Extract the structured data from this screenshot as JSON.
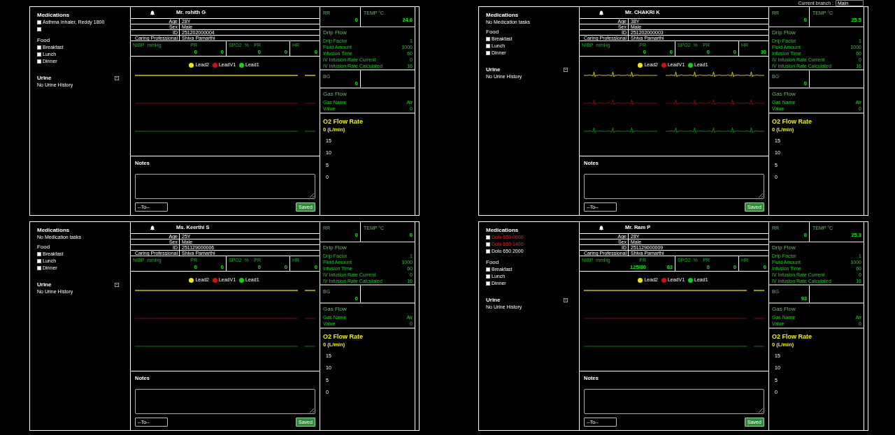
{
  "branch": {
    "label": "Current branch :",
    "value": "Main"
  },
  "panels": [
    {
      "medications": {
        "title": "Medications",
        "items": [
          {
            "label": "Asthma Inhaler, Reddy 1800",
            "checked": false,
            "overdue": false
          },
          {
            "checked": false
          }
        ]
      },
      "food": {
        "title": "Food",
        "items": [
          {
            "label": "Breakfast",
            "checked": false
          },
          {
            "label": "Lunch",
            "checked": false
          },
          {
            "label": "Dinner",
            "checked": false
          }
        ]
      },
      "urine": {
        "title": "Urine",
        "empty_text": "No Urine History"
      },
      "patient": {
        "name": "Mr. rohith G",
        "fields": [
          {
            "label": "Age",
            "value": "28Y"
          },
          {
            "label": "Sex",
            "value": "Male"
          },
          {
            "label": "ID",
            "value": "251202000004"
          },
          {
            "label": "Caring Professional",
            "value": "Shiva Pamarthi"
          }
        ]
      },
      "vitals": [
        {
          "label": "NIBP mmHg",
          "sub_label": "PR",
          "value": "0",
          "sub_value": "0"
        },
        {
          "label": "SPO2 %",
          "sub_label": "PR",
          "value": "0",
          "sub_value": "0"
        },
        {
          "label": "HR",
          "value": "0"
        }
      ],
      "ecg": {
        "signal": false,
        "leads": [
          {
            "name": "Lead2",
            "color": "#f2e21c"
          },
          {
            "name": "LeadV1",
            "color": "#c81414"
          },
          {
            "name": "Lead1",
            "color": "#1ec81e"
          }
        ]
      },
      "notes": {
        "title": "Notes",
        "recipient": "--To--",
        "button": "Saved"
      },
      "rr": {
        "label": "RR",
        "value": "0"
      },
      "temp": {
        "label": "TEMP °C",
        "value": "24.6"
      },
      "drip_flow": {
        "title": "Drip Flow",
        "rows": [
          {
            "label": "Drip Factor",
            "value": "1"
          },
          {
            "label": "Fluid Amount",
            "value": "1000"
          },
          {
            "label": "Infusion Time",
            "value": "60"
          },
          {
            "label": "IV Infusion Rate Current",
            "value": "0"
          },
          {
            "label": "IV Infusion Rate Calculated",
            "value": "16"
          }
        ]
      },
      "bg": {
        "label": "BG",
        "value": "0"
      },
      "gas_flow": {
        "title": "Gas Flow",
        "rows": [
          {
            "label": "Gas Name",
            "value": "Air"
          },
          {
            "label": "Value",
            "value": "0"
          }
        ]
      },
      "o2_flow": {
        "title": "O2 Flow Rate",
        "reading": "0 (L/min)",
        "y_ticks": [
          "15",
          "10",
          "5",
          "0"
        ]
      }
    },
    {
      "medications": {
        "title": "Medications",
        "empty_text": "No Medication tasks"
      },
      "food": {
        "title": "Food",
        "items": [
          {
            "label": "Breakfast",
            "checked": false
          },
          {
            "label": "Lunch",
            "checked": false
          },
          {
            "label": "Dinner",
            "checked": false
          }
        ]
      },
      "urine": {
        "title": "Urine",
        "empty_text": "No Urine History"
      },
      "patient": {
        "name": "Mr. CHAKRI K",
        "fields": [
          {
            "label": "Age",
            "value": "38Y"
          },
          {
            "label": "Sex",
            "value": "Male"
          },
          {
            "label": "ID",
            "value": "251202000003"
          },
          {
            "label": "Caring Professional",
            "value": "Shiva Pamarthi"
          }
        ]
      },
      "vitals": [
        {
          "label": "NIBP mmHg",
          "sub_label": "PR",
          "value": "0",
          "sub_value": "0"
        },
        {
          "label": "SPO2 %",
          "sub_label": "PR",
          "value": "0",
          "sub_value": "0"
        },
        {
          "label": "HR",
          "value": "30"
        }
      ],
      "ecg": {
        "signal": true,
        "leads": [
          {
            "name": "Lead2",
            "color": "#f2e21c"
          },
          {
            "name": "LeadV1",
            "color": "#c81414"
          },
          {
            "name": "Lead1",
            "color": "#1ec81e"
          }
        ]
      },
      "notes": {
        "title": "Notes",
        "recipient": "--To--",
        "button": "Saved"
      },
      "rr": {
        "label": "RR",
        "value": "0"
      },
      "temp": {
        "label": "TEMP °C",
        "value": "25.5"
      },
      "drip_flow": {
        "title": "Drip Flow",
        "rows": [
          {
            "label": "Drip Factor",
            "value": "1"
          },
          {
            "label": "Fluid Amount",
            "value": "1000"
          },
          {
            "label": "Infusion Time",
            "value": "60"
          },
          {
            "label": "IV Infusion Rate Current",
            "value": "0"
          },
          {
            "label": "IV Infusion Rate Calculated",
            "value": "16"
          }
        ]
      },
      "bg": {
        "label": "BG",
        "value": "0"
      },
      "gas_flow": {
        "title": "Gas Flow",
        "rows": [
          {
            "label": "Gas Name",
            "value": "Air"
          },
          {
            "label": "Value",
            "value": "0"
          }
        ]
      },
      "o2_flow": {
        "title": "O2 Flow Rate",
        "reading": "0 (L/min)",
        "y_ticks": [
          "15",
          "10",
          "5",
          "0"
        ]
      }
    },
    {
      "medications": {
        "title": "Medications",
        "empty_text": "No Medication tasks"
      },
      "food": {
        "title": "Food",
        "items": [
          {
            "label": "Breakfast",
            "checked": false
          },
          {
            "label": "Lunch",
            "checked": false
          },
          {
            "label": "Dinner",
            "checked": false
          }
        ]
      },
      "urine": {
        "title": "Urine",
        "empty_text": "No Urine History"
      },
      "patient": {
        "name": "Ms. Keerthi S",
        "fields": [
          {
            "label": "Age",
            "value": "25Y"
          },
          {
            "label": "Sex",
            "value": "Male"
          },
          {
            "label": "ID",
            "value": "251129000006"
          },
          {
            "label": "Caring Professional",
            "value": "Shiva Pamarthi"
          }
        ]
      },
      "vitals": [
        {
          "label": "NIBP mmHg",
          "sub_label": "PR",
          "value": "0",
          "sub_value": "0"
        },
        {
          "label": "SPO2 %",
          "sub_label": "PR",
          "value": "0",
          "sub_value": "0"
        },
        {
          "label": "HR",
          "value": "0"
        }
      ],
      "ecg": {
        "signal": false,
        "leads": [
          {
            "name": "Lead2",
            "color": "#f2e21c"
          },
          {
            "name": "LeadV1",
            "color": "#c81414"
          },
          {
            "name": "Lead1",
            "color": "#1ec81e"
          }
        ]
      },
      "notes": {
        "title": "Notes",
        "recipient": "--To--",
        "button": "Saved"
      },
      "rr": {
        "label": "RR",
        "value": "0"
      },
      "temp": {
        "label": "TEMP °C",
        "value": "0"
      },
      "drip_flow": {
        "title": "Drip Flow",
        "rows": [
          {
            "label": "Drip Factor",
            "value": "1"
          },
          {
            "label": "Fluid Amount",
            "value": "1000"
          },
          {
            "label": "Infusion Time",
            "value": "60"
          },
          {
            "label": "IV Infusion Rate Current",
            "value": "0"
          },
          {
            "label": "IV Infusion Rate Calculated",
            "value": "16"
          }
        ]
      },
      "bg": {
        "label": "BG",
        "value": "0"
      },
      "gas_flow": {
        "title": "Gas Flow",
        "rows": [
          {
            "label": "Gas Name",
            "value": "Air"
          },
          {
            "label": "Value",
            "value": "0"
          }
        ]
      },
      "o2_flow": {
        "title": "O2 Flow Rate",
        "reading": "0 (L/min)",
        "y_ticks": [
          "15",
          "10",
          "5",
          "0"
        ]
      }
    },
    {
      "medications": {
        "title": "Medications",
        "items": [
          {
            "label": "Dolo 650 0900",
            "checked": false,
            "overdue": true
          },
          {
            "label": "Dolo 650 1400",
            "checked": false,
            "overdue": true
          },
          {
            "label": "Dolo 650 2000",
            "checked": false,
            "overdue": false
          }
        ]
      },
      "food": {
        "title": "Food",
        "items": [
          {
            "label": "Breakfast",
            "checked": false
          },
          {
            "label": "Lunch",
            "checked": false
          },
          {
            "label": "Dinner",
            "checked": false
          }
        ]
      },
      "urine": {
        "title": "Urine",
        "empty_text": "No Urine History"
      },
      "patient": {
        "name": "Mr. Ram P",
        "fields": [
          {
            "label": "Age",
            "value": "28Y"
          },
          {
            "label": "Sex",
            "value": "Male"
          },
          {
            "label": "ID",
            "value": "251129000009"
          },
          {
            "label": "Caring Professional",
            "value": "Shiva Pamarthi"
          }
        ]
      },
      "vitals": [
        {
          "label": "NIBP mmHg",
          "sub_label": "PR",
          "value": "125/80",
          "sub_value": "83"
        },
        {
          "label": "SPO2 %",
          "sub_label": "PR",
          "value": "0",
          "sub_value": "0"
        },
        {
          "label": "HR",
          "value": "0"
        }
      ],
      "ecg": {
        "signal": false,
        "leads": [
          {
            "name": "Lead2",
            "color": "#f2e21c"
          },
          {
            "name": "LeadV1",
            "color": "#c81414"
          },
          {
            "name": "Lead1",
            "color": "#1ec81e"
          }
        ]
      },
      "notes": {
        "title": "Notes",
        "recipient": "--To--",
        "button": "Saved"
      },
      "rr": {
        "label": "RR",
        "value": "0"
      },
      "temp": {
        "label": "TEMP °C",
        "value": "25.3"
      },
      "drip_flow": {
        "title": "Drip Flow",
        "rows": [
          {
            "label": "Drip Factor",
            "value": "1"
          },
          {
            "label": "Fluid Amount",
            "value": "1000"
          },
          {
            "label": "Infusion Time",
            "value": "60"
          },
          {
            "label": "IV Infusion Rate Current",
            "value": "0"
          },
          {
            "label": "IV Infusion Rate Calculated",
            "value": "16"
          }
        ]
      },
      "bg": {
        "label": "BG",
        "value": "93"
      },
      "gas_flow": {
        "title": "Gas Flow",
        "rows": [
          {
            "label": "Gas Name",
            "value": "Air"
          },
          {
            "label": "Value",
            "value": "0"
          }
        ]
      },
      "o2_flow": {
        "title": "O2 Flow Rate",
        "reading": "0 (L/min)",
        "y_ticks": [
          "15",
          "10",
          "5",
          "0"
        ]
      }
    }
  ]
}
